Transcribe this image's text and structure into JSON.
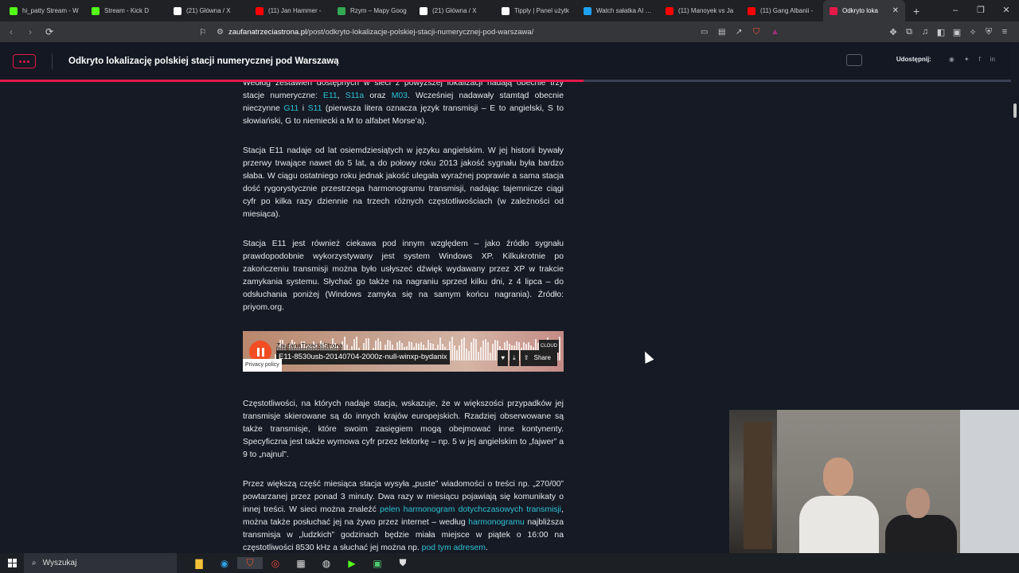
{
  "browser": {
    "tabs": [
      {
        "label": "hi_patty Stream - W",
        "favicon": "kick-icon",
        "color": "#53fc18"
      },
      {
        "label": "Stream - Kick D",
        "favicon": "kick-icon",
        "color": "#53fc18"
      },
      {
        "label": "(21) Główna / X",
        "favicon": "x-icon",
        "color": "#ffffff"
      },
      {
        "label": "(11) Jan Hammer -",
        "favicon": "youtube-icon",
        "color": "#ff0000"
      },
      {
        "label": "Rzym – Mapy Goog",
        "favicon": "maps-icon",
        "color": "#34a853"
      },
      {
        "label": "(21) Główna / X",
        "favicon": "x-icon",
        "color": "#ffffff"
      },
      {
        "label": "Tipply | Panel użytk",
        "favicon": "tipply-icon",
        "color": "#ffffff"
      },
      {
        "label": "Watch sałatka AI | S",
        "favicon": "watch-icon",
        "color": "#1da1f2"
      },
      {
        "label": "(11) Manoyek vs Ja",
        "favicon": "youtube-icon",
        "color": "#ff0000"
      },
      {
        "label": "(11) Gang Albanii -",
        "favicon": "youtube-icon",
        "color": "#ff0000"
      },
      {
        "label": "Odkryto loka",
        "favicon": "zaufana-icon",
        "color": "#e5194a",
        "active": true
      }
    ],
    "url_host": "zaufanatrzeciastrona.pl",
    "url_path": "/post/odkryto-lokalizacje-polskiej-stacji-numerycznej-pod-warszawa/"
  },
  "header": {
    "title": "Odkryto lokalizację polskiej stacji numerycznej pod Warszawą",
    "share_label": "Udostępnij:",
    "accent": "#e5194a"
  },
  "article": {
    "p1": {
      "t1": "Według zestawień dostępnych w sieci z powyższej lokalizacji nadają obecnie trzy stacje numeryczne: ",
      "l1": "E11",
      "t2": ", ",
      "l2": "S11a",
      "t3": " oraz ",
      "l3": "M03",
      "t4": ". Wcześniej nadawały stamtąd obecnie nieczynne ",
      "l4": "G11",
      "t5": " i ",
      "l5": "S11",
      "t6": " (pierwsza litera oznacza język transmisji – E to angielski, S to słowiański, G to niemiecki a M to alfabet Morse’a)."
    },
    "p2": "Stacja E11 nadaje od lat osiemdziesiątych w języku angielskim. W jej historii bywały przerwy trwające nawet do 5 lat, a do połowy roku 2013 jakość sygnału była bardzo słaba. W ciągu ostatniego roku jednak jakość ulegała wyraźnej poprawie a sama stacja dość rygorystycznie przestrzega harmonogramu transmisji, nadając tajemnicze ciągi cyfr po kilka razy dziennie na trzech różnych częstotliwościach (w zależności od miesiąca).",
    "p3": "Stacja E11 jest również ciekawa pod innym względem – jako źródło sygnału prawdopodobnie wykorzystywany jest system Windows XP. Kilkukrotnie po zakończeniu transmisji można było usłyszeć dźwięk wydawany przez XP w trakcie zamykania systemu. Słychać go także na nagraniu sprzed kilku dni, z 4 lipca – do odsłuchania poniżej (Windows zamyka się na samym końcu nagrania). Źródło: priyom.org.",
    "p4": "Częstotliwości, na których nadaje stacja, wskazuje, że w większości przypadków jej transmisje skierowane są do innych krajów europejskich. Rzadziej obserwowane są także transmisje, które swoim zasięgiem mogą obejmować inne kontynenty. Specyficzna jest także wymowa cyfr przez lektorkę – np. 5 w jej angielskim to „fajwer” a 9 to „najnul”.",
    "p5": {
      "t1": "Przez większą część miesiąca stacja wysyła „puste” wiadomości o treści np. „270/00” powtarzanej przez ponad 3 minuty. Dwa razy w miesiącu pojawiają się komunikaty o innej treści. W sieci można znaleźć ",
      "l1": "pelen harmonogram dotychczasowych transmisji",
      "t2": ", można także posłuchać jej na żywo przez internet – według ",
      "l2": "harmonogramu",
      "t3": " najbliższa transmisja w „ludzkich” godzinach będzie miała miejsce w piątek o 16:00 na częstotliwości 8530 kHz a słuchać jej można np. ",
      "l3": "pod tym adresem",
      "t4": "."
    }
  },
  "player": {
    "author": "ZaufanaTrzeciaStrona",
    "track": "E11-8530usb-20140704-2000z-null-winxp-bydanix",
    "share": "Share",
    "privacy": "Privacy policy",
    "cloud": "CLOUD"
  },
  "taskbar": {
    "search_placeholder": "Wyszukaj"
  }
}
